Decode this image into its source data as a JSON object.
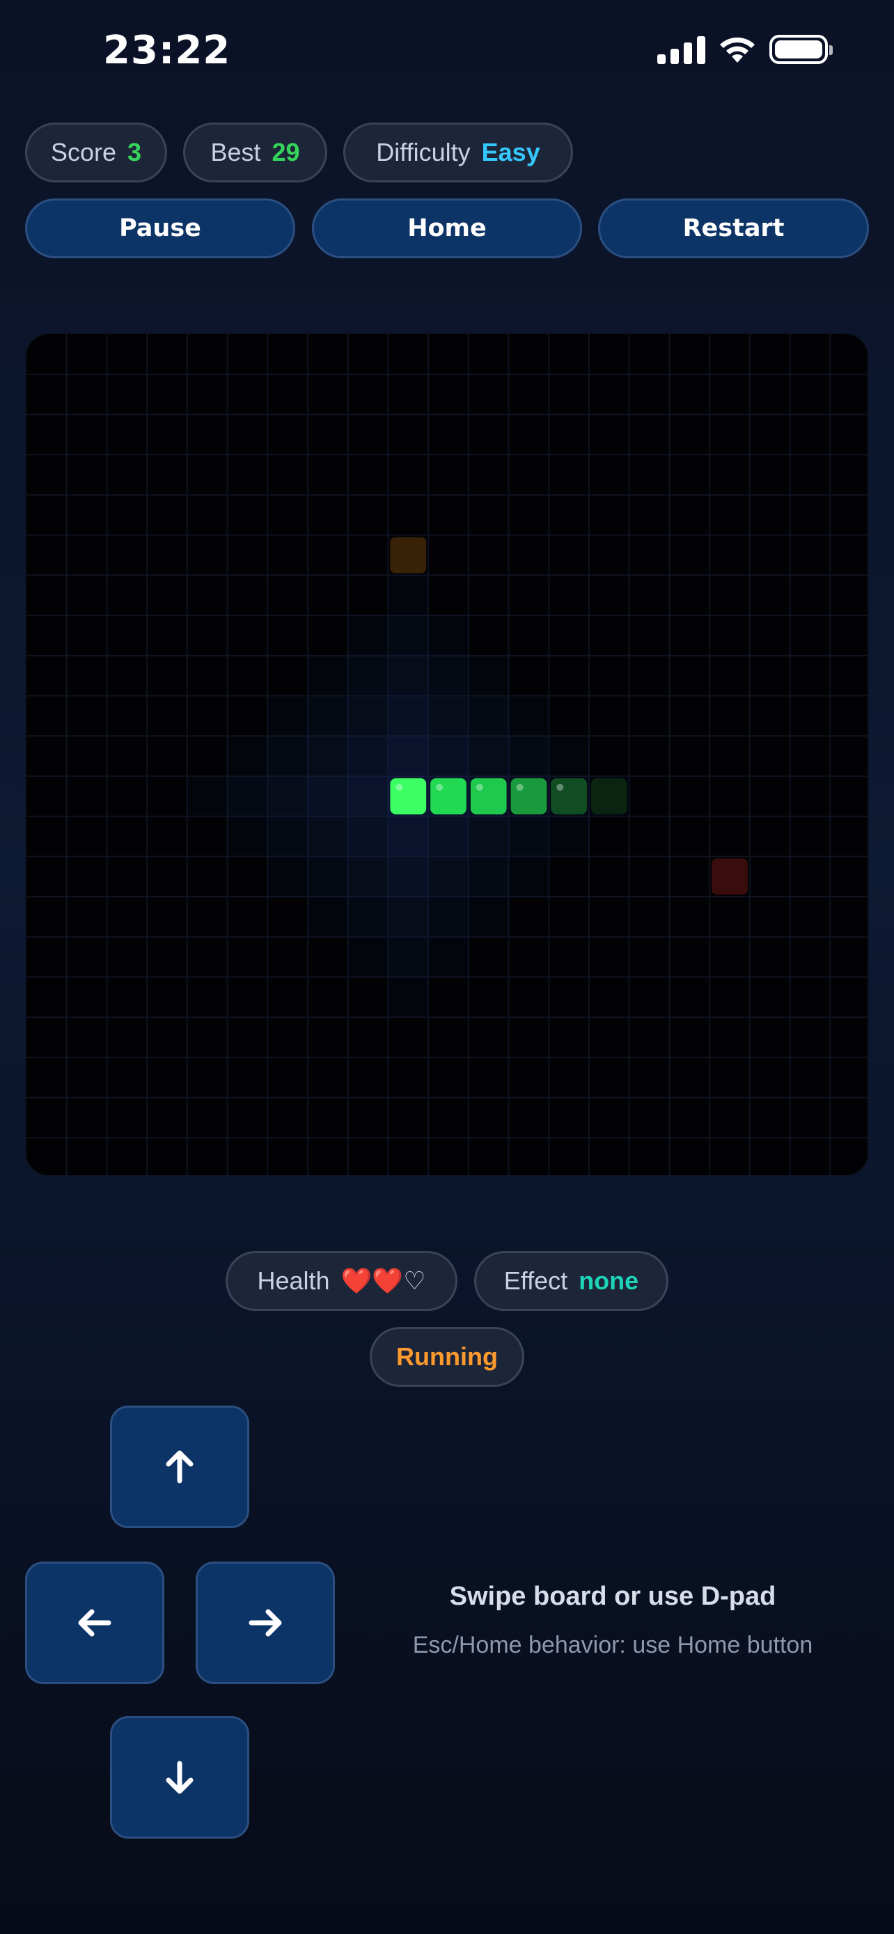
{
  "status_bar": {
    "time": "23:22"
  },
  "stats": {
    "score_label": "Score",
    "score_value": "3",
    "best_label": "Best",
    "best_value": "29",
    "difficulty_label": "Difficulty",
    "difficulty_value": "Easy"
  },
  "controls": {
    "pause_label": "Pause",
    "home_label": "Home",
    "restart_label": "Restart"
  },
  "status": {
    "health_label": "Health",
    "health_hearts": "❤️❤️♡",
    "effect_label": "Effect",
    "effect_value": "none",
    "state_label": "Running"
  },
  "dpad": {
    "up_icon": "arrow-up-icon",
    "left_icon": "arrow-left-icon",
    "right_icon": "arrow-right-icon",
    "down_icon": "arrow-down-icon"
  },
  "hints": {
    "main": "Swipe board or use D-pad",
    "sub": "Esc/Home behavior: use Home button"
  },
  "colors": {
    "accent_green": "#35d45b",
    "accent_cyan": "#35c8ff",
    "accent_teal": "#1ed4b8",
    "accent_orange": "#ff9a2e",
    "button_bg": "#0d3466"
  },
  "game": {
    "grid_size": 21,
    "snake": [
      [
        9,
        11
      ],
      [
        10,
        11
      ],
      [
        11,
        11
      ],
      [
        12,
        11
      ],
      [
        13,
        11
      ],
      [
        14,
        11
      ]
    ],
    "food_items": [
      {
        "cell": [
          9,
          5
        ],
        "color": "#3a2208"
      },
      {
        "cell": [
          17,
          13
        ],
        "color": "#3a0d0d"
      }
    ]
  }
}
